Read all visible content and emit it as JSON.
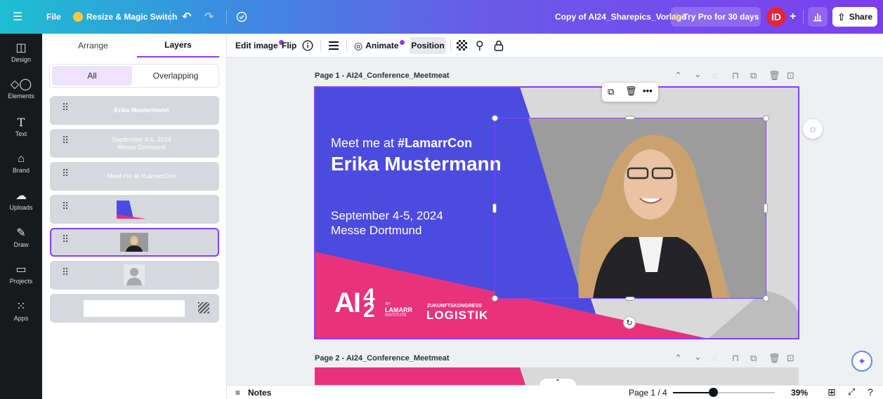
{
  "topbar": {
    "menu_icon": "hamburger-icon",
    "file_label": "File",
    "resize_label": "Resize & Magic Switch",
    "doc_title": "Copy of AI24_Sharepics_Vorlage",
    "try_pro_label": "Try Pro for 30 days",
    "avatar_initials": "ID",
    "share_label": "Share"
  },
  "rail": {
    "items": [
      {
        "label": "Design",
        "icon": "design-icon"
      },
      {
        "label": "Elements",
        "icon": "elements-icon"
      },
      {
        "label": "Text",
        "icon": "text-icon"
      },
      {
        "label": "Brand",
        "icon": "brand-icon"
      },
      {
        "label": "Uploads",
        "icon": "uploads-icon"
      },
      {
        "label": "Draw",
        "icon": "draw-icon"
      },
      {
        "label": "Projects",
        "icon": "projects-icon"
      },
      {
        "label": "Apps",
        "icon": "apps-icon"
      }
    ]
  },
  "panel": {
    "tabs": [
      "Arrange",
      "Layers"
    ],
    "active_tab": "Layers",
    "segments": [
      "All",
      "Overlapping"
    ],
    "layers": [
      {
        "line1": "Erika Mustermann",
        "line2": ""
      },
      {
        "line1": "September 4-5, 2024",
        "line2": "Messe Dortmund"
      },
      {
        "line1": "Meet me at #LamarrCon",
        "line2": ""
      }
    ]
  },
  "ctx": {
    "edit_image": "Edit image",
    "flip": "Flip",
    "animate": "Animate",
    "position": "Position"
  },
  "canvas": {
    "page1_title": "Page 1 - AI24_Conference_Meetmeat",
    "page2_title": "Page 2 - AI24_Conference_Meetmeat",
    "meet_prefix": "Meet me at ",
    "meet_tag": "#LamarrCon",
    "name": "Erika Mustermann",
    "date": "September 4-5, 2024",
    "venue": "Messe Dortmund",
    "logo_ai": "AI",
    "logo_by": "BY",
    "logo_lamarr": "LAMARR",
    "logo_institute": "INSTITUTE",
    "logo_zk": "ZUKUNFTSKONGRESS",
    "logo_logistik": "LOGISTIK"
  },
  "bottom": {
    "notes_label": "Notes",
    "page_indicator": "Page 1 / 4",
    "zoom": "39%",
    "zoom_fraction": 0.39
  },
  "colors": {
    "accent": "#8b3dff",
    "blue": "#4b4be0",
    "pink": "#e8327c",
    "avatar": "#e0263c"
  }
}
